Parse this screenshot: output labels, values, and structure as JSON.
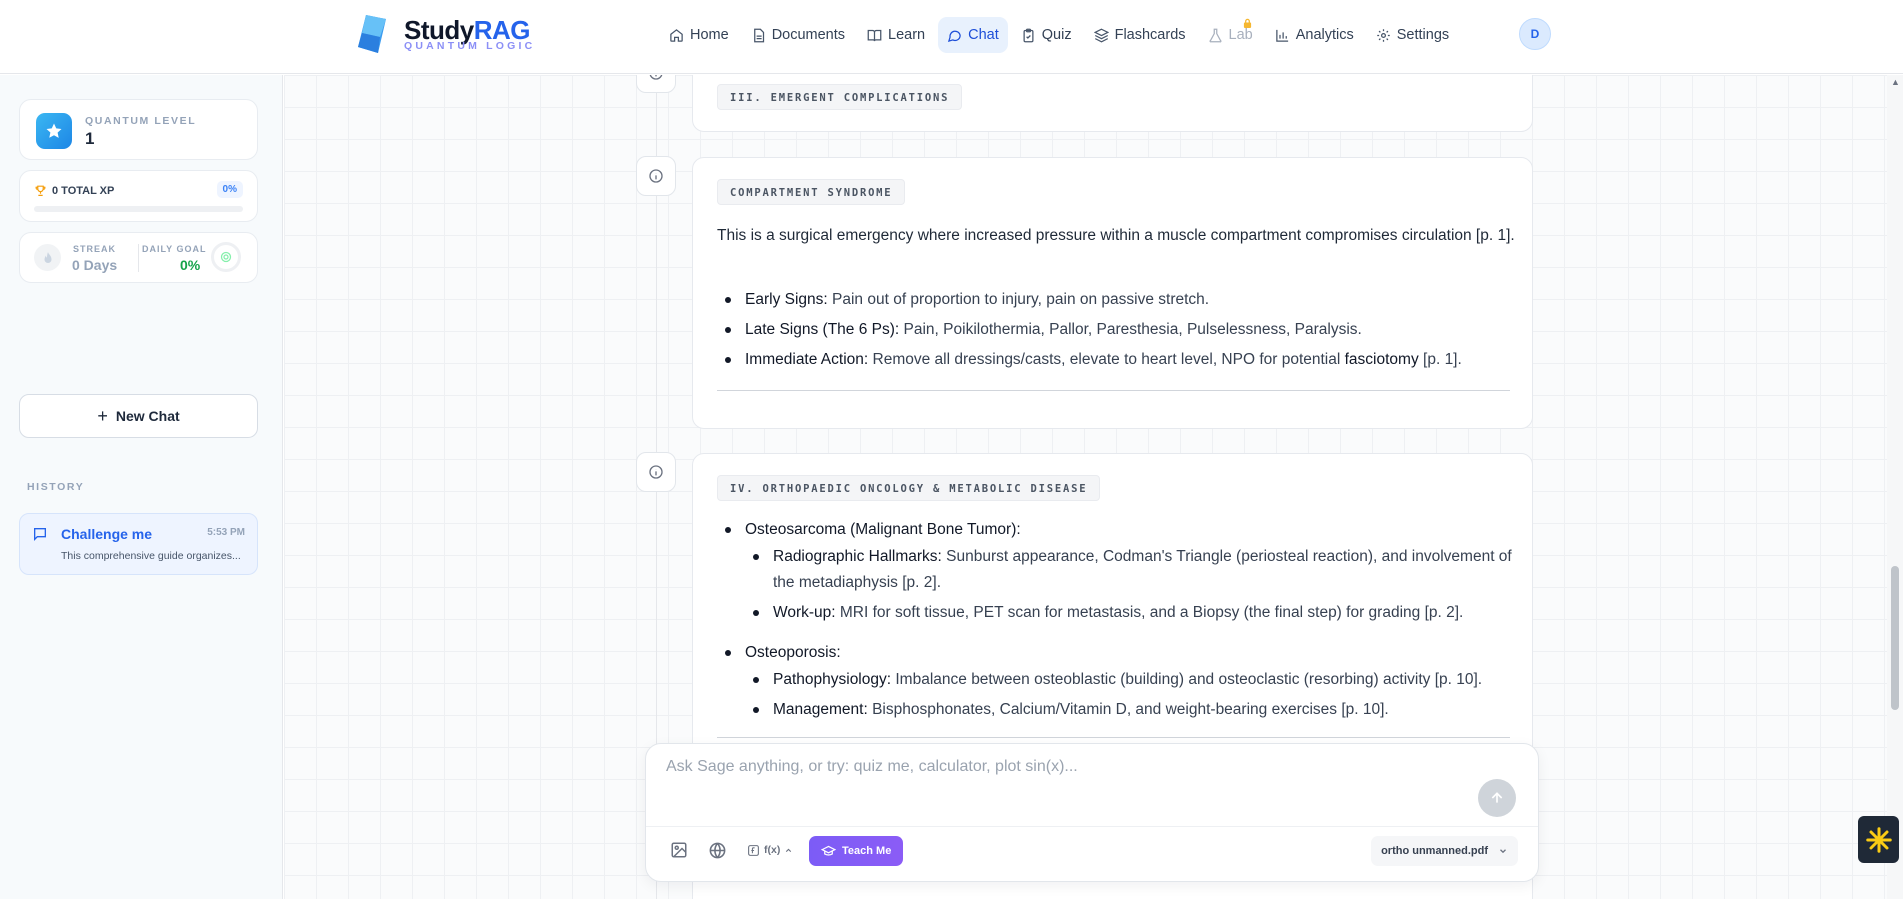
{
  "app": {
    "brand_main": "Study",
    "brand_accent": "RAG",
    "brand_sub": "QUANTUM LOGIC"
  },
  "nav": [
    {
      "label": "Home",
      "icon": "home-icon",
      "active": false
    },
    {
      "label": "Documents",
      "icon": "document-icon",
      "active": false
    },
    {
      "label": "Learn",
      "icon": "book-icon",
      "active": false
    },
    {
      "label": "Chat",
      "icon": "chat-icon",
      "active": true
    },
    {
      "label": "Quiz",
      "icon": "clipboard-icon",
      "active": false
    },
    {
      "label": "Flashcards",
      "icon": "layers-icon",
      "active": false
    },
    {
      "label": "Lab",
      "icon": "flask-icon",
      "locked": true
    },
    {
      "label": "Analytics",
      "icon": "bar-chart-icon",
      "active": false
    },
    {
      "label": "Settings",
      "icon": "gear-icon",
      "active": false
    }
  ],
  "user": {
    "initial": "D"
  },
  "sidebar": {
    "quantum_level_label": "QUANTUM LEVEL",
    "quantum_level_value": "1",
    "xp_label": "0 TOTAL XP",
    "xp_percent_label": "0%",
    "xp_progress": 0,
    "streak_label": "STREAK",
    "streak_value": "0 Days",
    "daily_goal_label": "DAILY GOAL",
    "daily_goal_value": "0%",
    "new_chat_label": "New Chat",
    "history_label": "HISTORY",
    "history": [
      {
        "title": "Challenge me",
        "time": "5:53 PM",
        "preview": "This comprehensive guide organizes..."
      }
    ]
  },
  "messages": {
    "section3_tag": "III. EMERGENT COMPLICATIONS",
    "compartment": {
      "tag": "COMPARTMENT SYNDROME",
      "intro": "This is a surgical emergency where increased pressure within a muscle compartment compromises circulation [p. 1].",
      "items": [
        {
          "term": "Early Signs:",
          "text": " Pain out of proportion to injury, pain on passive stretch."
        },
        {
          "term": "Late Signs (The 6 Ps):",
          "text": " Pain, Poikilothermia, Pallor, Paresthesia, Pulselessness, Paralysis."
        },
        {
          "term": "Immediate Action:",
          "text": " Remove all dressings/casts, elevate to heart level, NPO for potential ",
          "term2": "fasciotomy",
          "text2": " [p. 1]."
        }
      ]
    },
    "oncology": {
      "tag": "IV. ORTHOPAEDIC ONCOLOGY & METABOLIC DISEASE",
      "groups": [
        {
          "title": "Osteosarcoma (Malignant Bone Tumor):",
          "items": [
            {
              "term": "Radiographic Hallmarks:",
              "text": " Sunburst appearance, Codman's Triangle (periosteal reaction), and involvement of the metadiaphysis [p. 2]."
            },
            {
              "term": "Work-up:",
              "text": " MRI for soft tissue, PET scan for metastasis, and a Biopsy (the final step) for grading [p. 2]."
            }
          ]
        },
        {
          "title": "Osteoporosis:",
          "items": [
            {
              "term": "Pathophysiology:",
              "text": " Imbalance between osteoblastic (building) and osteoclastic (resorbing) activity [p. 10]."
            },
            {
              "term": "Management:",
              "text": " Bisphosphonates, Calcium/Vitamin D, and weight-bearing exercises [p. 10]."
            }
          ]
        }
      ]
    }
  },
  "composer": {
    "placeholder": "Ask Sage anything, or try: quiz me, calculator, plot sin(x)...",
    "fx_label": "f(x)",
    "teach_label": "Teach Me",
    "file_label": "ortho unmanned.pdf"
  },
  "colors": {
    "accent": "#2563eb",
    "teach": "#7c5cf6",
    "goal": "#16a34a"
  }
}
